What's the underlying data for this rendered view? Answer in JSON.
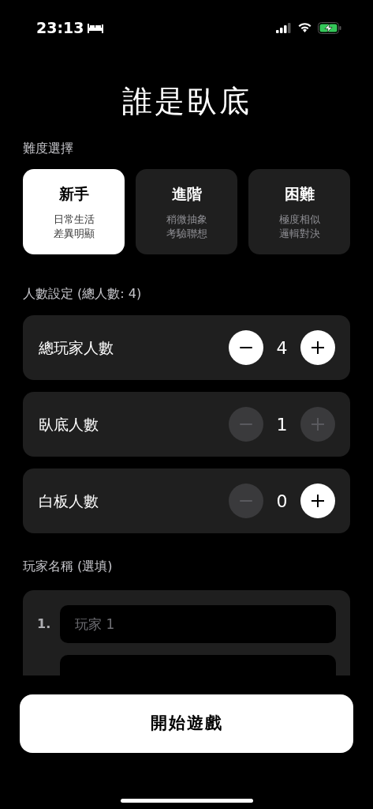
{
  "status_bar": {
    "time": "23:13"
  },
  "title": "誰是臥底",
  "difficulty": {
    "label": "難度選擇",
    "options": [
      {
        "name": "新手",
        "description": [
          "日常生活",
          "差異明顯"
        ],
        "selected": true
      },
      {
        "name": "進階",
        "description": [
          "稍微抽象",
          "考驗聯想"
        ],
        "selected": false
      },
      {
        "name": "困難",
        "description": [
          "極度相似",
          "邏輯對決"
        ],
        "selected": false
      }
    ]
  },
  "players": {
    "label": "人數設定 (總人數: 4)",
    "rows": [
      {
        "name": "總玩家人數",
        "value": "4",
        "minus_disabled": false,
        "plus_disabled": false
      },
      {
        "name": "臥底人數",
        "value": "1",
        "minus_disabled": true,
        "plus_disabled": true
      },
      {
        "name": "白板人數",
        "value": "0",
        "minus_disabled": true,
        "plus_disabled": false
      }
    ]
  },
  "names": {
    "label": "玩家名稱 (選填)",
    "fields": [
      {
        "number": "1.",
        "placeholder": "玩家 1"
      },
      {
        "cut": true
      }
    ]
  },
  "start_button": "開始遊戲"
}
